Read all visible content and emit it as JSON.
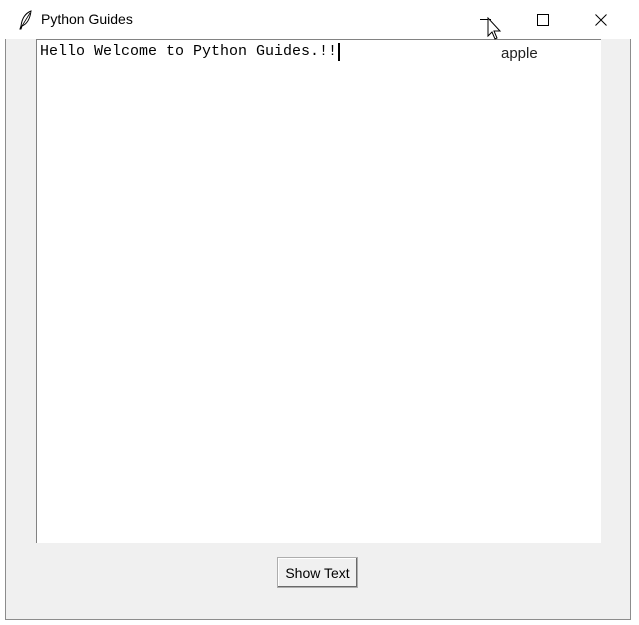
{
  "window": {
    "title": "Python Guides",
    "icon": "feather-icon",
    "controls": {
      "minimize": "minimize-icon",
      "maximize": "maximize-icon",
      "close": "close-icon"
    }
  },
  "tooltip": {
    "text": "apple"
  },
  "text_widget": {
    "content": "Hello Welcome to Python Guides.!!"
  },
  "button": {
    "label": "Show Text"
  }
}
